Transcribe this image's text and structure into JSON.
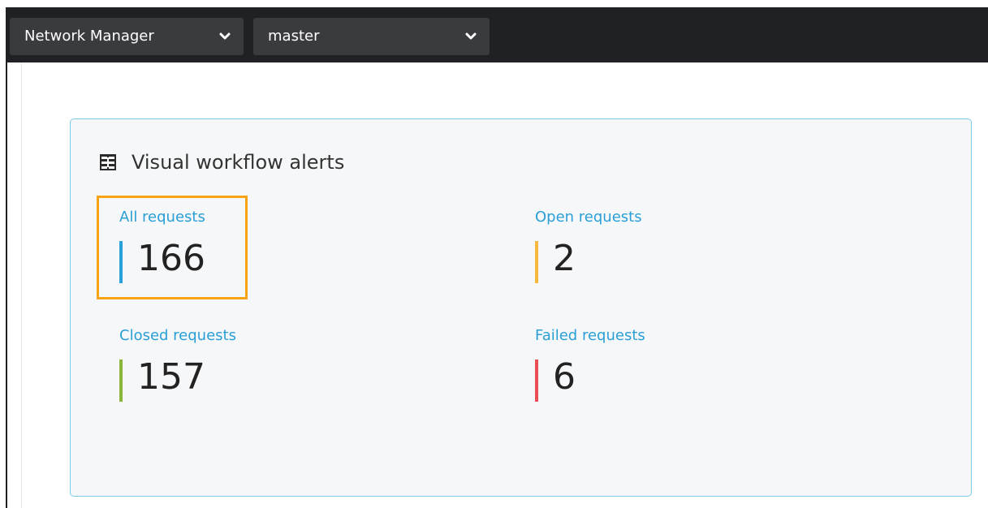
{
  "topbar": {
    "product_dropdown": {
      "value": "Network Manager",
      "icon": "chevron-down-icon"
    },
    "branch_dropdown": {
      "value": "master",
      "icon": "chevron-down-icon"
    }
  },
  "card": {
    "title": "Visual workflow alerts",
    "title_icon": "workflow-icon",
    "metrics": [
      {
        "label": "All requests",
        "value": "166",
        "color": "#2aa0db"
      },
      {
        "label": "Open requests",
        "value": "2",
        "color": "#f6b83d"
      },
      {
        "label": "Closed requests",
        "value": "157",
        "color": "#8bb63b"
      },
      {
        "label": "Failed requests",
        "value": "6",
        "color": "#ec4d55"
      }
    ]
  },
  "colors": {
    "topbar_bg": "#202124",
    "dropdown_bg": "#3a3b3e",
    "card_border": "#7ccce7",
    "card_bg": "#f5f7f8",
    "link": "#2a9fd6",
    "highlight": "#f7a414"
  }
}
